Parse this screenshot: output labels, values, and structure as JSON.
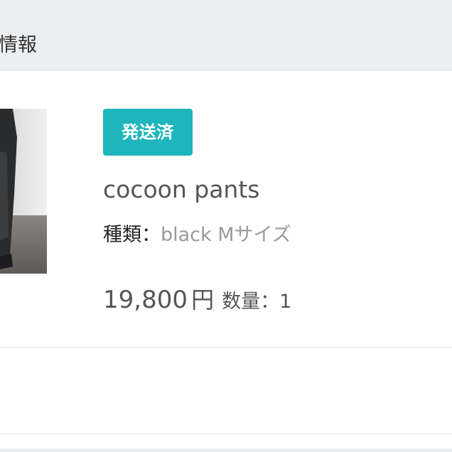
{
  "section": {
    "title": "情報"
  },
  "product": {
    "status_badge": "発送済",
    "name": "cocoon pants",
    "variant_label": "種類：",
    "variant_value": "black Mサイズ",
    "price_amount": "19,800",
    "price_currency": "円",
    "quantity_label": "数量：",
    "quantity_value": "1"
  },
  "colors": {
    "header_bg": "#eceef0",
    "badge_bg": "#1fb5bd",
    "badge_text": "#ffffff",
    "primary_text": "#555555",
    "muted_text": "#9a9a9a",
    "divider": "#e2e2e2"
  }
}
